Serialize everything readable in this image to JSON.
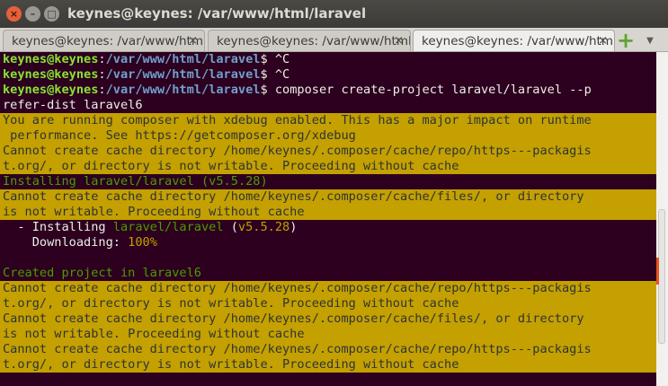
{
  "window": {
    "title": "keynes@keynes: /var/www/html/laravel",
    "close_glyph": "×",
    "min_glyph": "–",
    "max_glyph": "□"
  },
  "tabs": [
    {
      "label": "keynes@keynes: /var/www/html/laravel",
      "close": "×",
      "active": false
    },
    {
      "label": "keynes@keynes: /var/www/html/laravel",
      "close": "×",
      "active": false
    },
    {
      "label": "keynes@keynes: /var/www/html/laravel",
      "close": "×",
      "active": true
    }
  ],
  "tabbar": {
    "new_tab_icon": "plus-icon",
    "menu_icon": "chevron-down-icon",
    "new_tab_glyph": "+",
    "menu_glyph": "▼"
  },
  "prompt": {
    "user": "keynes@keynes",
    "sep": ":",
    "path": "/var/www/html/laravel",
    "sym": "$ "
  },
  "terminal": {
    "cmd1": "^C",
    "cmd2": "^C",
    "cmd3": "composer create-project laravel/laravel --p",
    "cmd3_wrap": "refer-dist laravel6",
    "warn1a": "You are running composer with xdebug enabled. This has a major impact on runtime",
    "warn1b": " performance. See https://getcomposer.org/xdebug",
    "cache1a": "Cannot create cache directory /home/keynes/.composer/cache/repo/https---packagis",
    "cache1b": "t.org/, or directory is not writable. Proceeding without cache",
    "installing": "Installing laravel/laravel (v5.5.28)",
    "cache2a": "Cannot create cache directory /home/keynes/.composer/cache/files/, or directory",
    "cache2b": "is not writable. Proceeding without cache",
    "inst_prefix": "  - Installing ",
    "inst_pkg": "laravel/laravel",
    "inst_paren_open": " (",
    "inst_version": "v5.5.28",
    "inst_paren_close": ")",
    "dl_label": "    Downloading: ",
    "dl_value": "100%",
    "blank": "",
    "created": "Created project in laravel6",
    "cache3a": "Cannot create cache directory /home/keynes/.composer/cache/repo/https---packagis",
    "cache3b": "t.org/, or directory is not writable. Proceeding without cache",
    "cache4a": "Cannot create cache directory /home/keynes/.composer/cache/files/, or directory",
    "cache4b": "is not writable. Proceeding without cache",
    "cache5a": "Cannot create cache directory /home/keynes/.composer/cache/repo/https---packagis",
    "cache5b": "t.org/, or directory is not writable. Proceeding without cache"
  },
  "colors": {
    "background": "#2c001e",
    "prompt_user": "#8ae234",
    "prompt_path": "#729fcf",
    "warning_bg": "#c4a000",
    "info_green": "#4e9a06"
  }
}
